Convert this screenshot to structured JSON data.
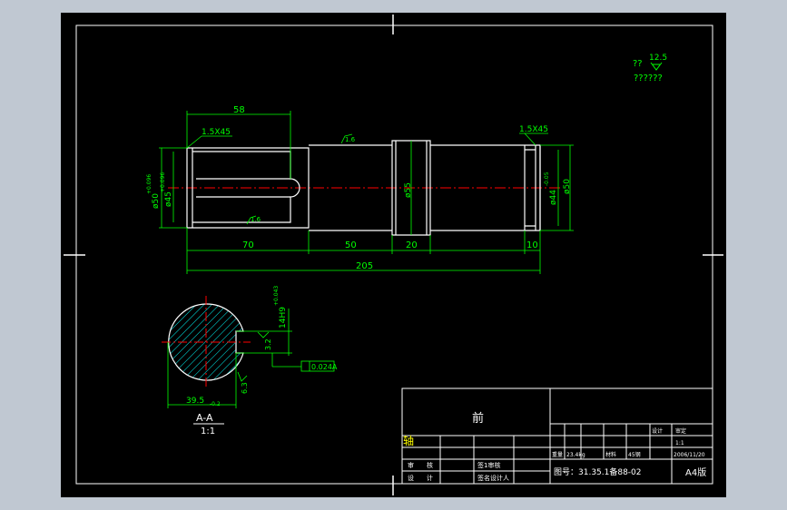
{
  "colors": {
    "frame_bg": "#000000",
    "outside_bg": "#c0c8d2",
    "line": "#ffffff",
    "dimension": "#00ff00",
    "center_line": "#ff0000",
    "hatch": "#00ffff",
    "page_border": "#ffffff"
  },
  "roughness": {
    "general_mark": "??",
    "general_value": "12.5",
    "general_note": "??????",
    "surface_1": "1.6",
    "surface_2": "1.6",
    "surface_3": "3.2"
  },
  "shaft": {
    "chamfer_left": "1.5X45",
    "chamfer_right": "1.5X45",
    "dim_keyway": "58",
    "dim_seg1": "70",
    "dim_seg2": "50",
    "dim_seg3": "20",
    "dim_seg4": "10",
    "dim_total": "205",
    "dia_left_outer": "ø50",
    "dia_left_outer_tol": "+0.096",
    "dia_left_key": "ø45",
    "dia_left_key_tol": "+0.096",
    "dia_collar": "ø55",
    "dia_right_inner": "ø44",
    "dia_right_inner_tol": "-0.05",
    "dia_right_outer": "ø50"
  },
  "section": {
    "key_width": "14H9",
    "key_width_tol": "+0.043",
    "depth": "39.5",
    "depth_tol": "-0.2",
    "roughness_side": "3.2",
    "roughness_bottom": "6.3",
    "symmetry_tol": "0.024A",
    "label": "A-A",
    "scale": "1:1"
  },
  "title_block": {
    "part_name": "前",
    "side_stamp": "轴",
    "r1": [
      "",
      "",
      "",
      "",
      "设计",
      "审定"
    ],
    "r2": [
      "",
      "",
      "",
      "",
      "",
      "1:1"
    ],
    "r3": [
      "重量",
      "23.4kg",
      "材料",
      "45钢",
      "",
      "2006/11/20"
    ],
    "left_rows": [
      [
        "审",
        "核",
        "",
        "签1审核"
      ],
      [
        "设",
        "计",
        "",
        "签名设计人"
      ]
    ],
    "drawing_no": "图号：31.35.1备88-02",
    "sheet_size": "A4版"
  }
}
